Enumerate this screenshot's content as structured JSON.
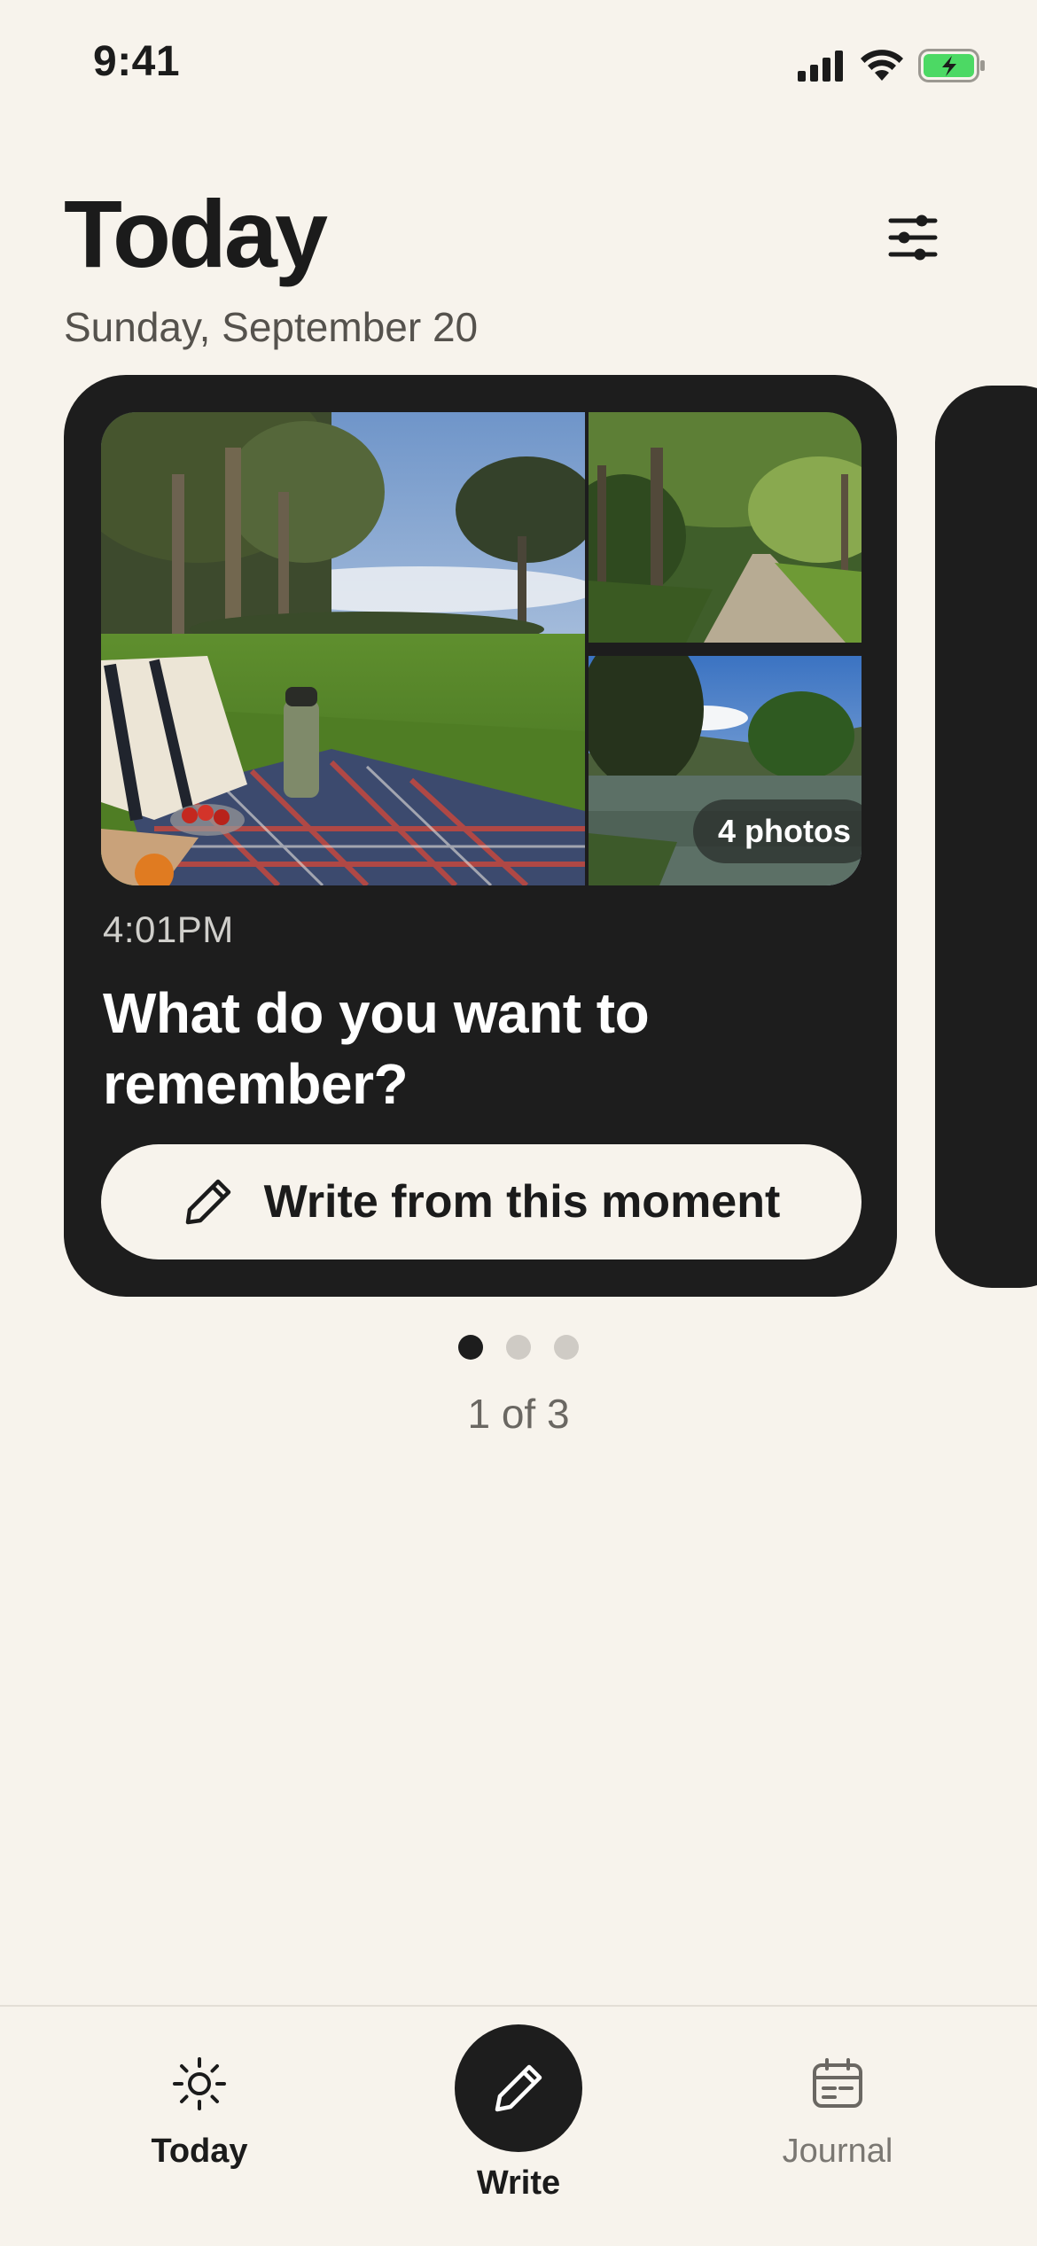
{
  "status_bar": {
    "time": "9:41",
    "icons": [
      "cellular-signal-icon",
      "wifi-icon",
      "battery-charging-icon"
    ]
  },
  "header": {
    "title": "Today",
    "date": "Sunday, September 20",
    "filter_icon": "sliders-icon"
  },
  "card": {
    "photo_count_label": "4 photos",
    "time": "4:01PM",
    "prompt": "What do you want to remember?",
    "action_label": "Write from this moment",
    "action_icon": "pencil-icon"
  },
  "pager": {
    "label": "1 of 3",
    "total": 3,
    "current": 1
  },
  "tab_bar": {
    "items": [
      {
        "label": "Today",
        "icon": "sun-icon",
        "selected": true
      },
      {
        "label": "Write",
        "icon": "pencil-icon"
      },
      {
        "label": "Journal",
        "icon": "calendar-icon"
      }
    ]
  },
  "colors": {
    "background": "#f7f3ec",
    "card": "#1d1d1d",
    "battery_green": "#4cd964"
  }
}
